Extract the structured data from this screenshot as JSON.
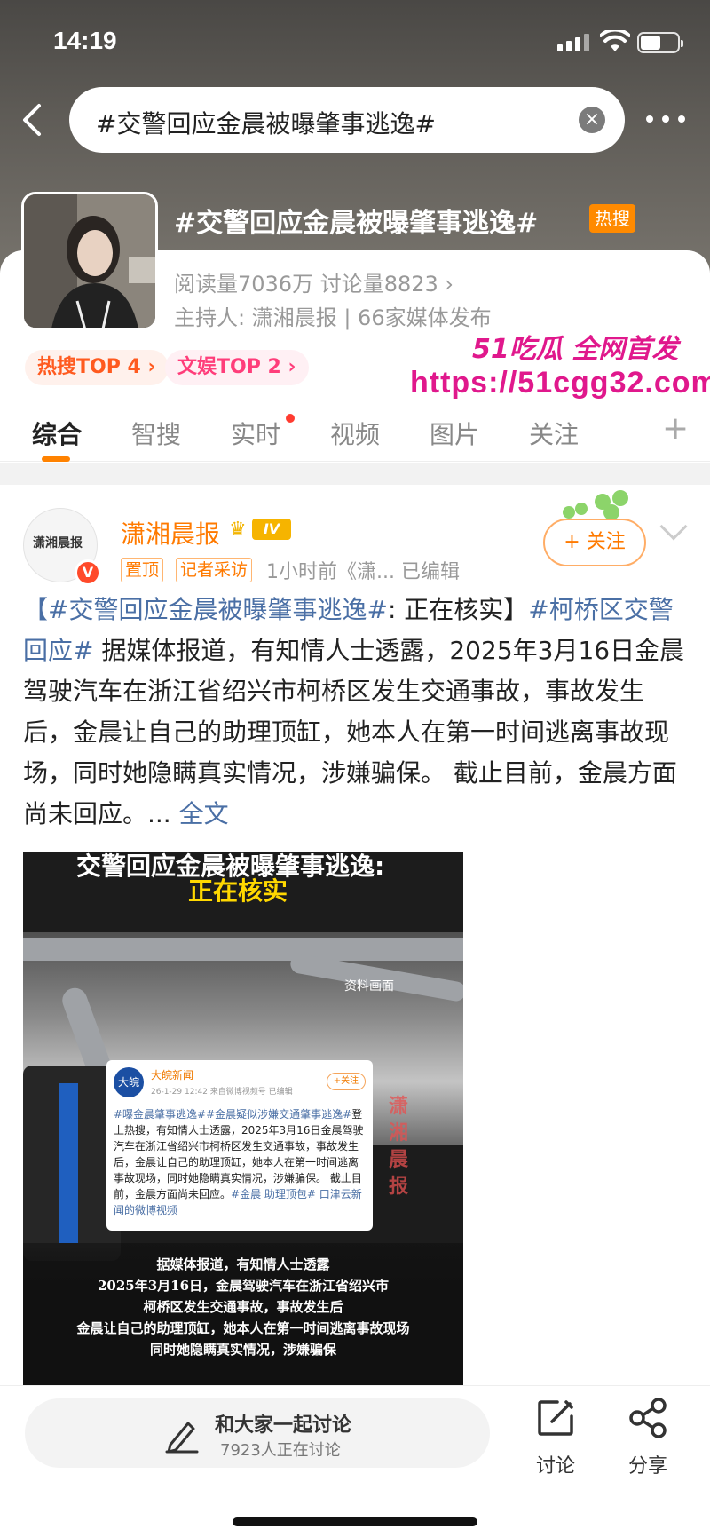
{
  "status": {
    "time": "14:19"
  },
  "search": {
    "query": "#交警回应金晨被曝肇事逃逸#",
    "clear_icon": "clear-x-icon"
  },
  "topic": {
    "title": "#交警回应金晨被曝肇事逃逸#",
    "hot_badge": "热搜",
    "stats": "阅读量7036万  讨论量8823  ›",
    "host": "主持人: 潇湘晨报 | 66家媒体发布",
    "chips": [
      "热搜TOP 4 ›",
      "文娱TOP 2 ›"
    ]
  },
  "watermark": {
    "top": "51吃瓜 全网首发",
    "url": "https://51cgg32.com"
  },
  "tabs": [
    "综合",
    "智搜",
    "实时",
    "视频",
    "图片",
    "关注"
  ],
  "post": {
    "author": "潇湘晨报",
    "avatar_text": "潇湘晨报",
    "level": "IV",
    "tags": [
      "置顶",
      "记者采访"
    ],
    "meta": "1小时前《潇...  已编辑",
    "follow": "+ 关注",
    "body_link1": "【#交警回应金晨被曝肇事逃逸#",
    "body_text1": ": 正在核实】",
    "body_link2": "#柯桥区交警回应#",
    "body_text2": " 据媒体报道，有知情人士透露，2025年3月16日金晨驾驶汽车在浙江省绍兴市柯桥区发生交通事故，事故发生后，金晨让自己的助理顶缸，她本人在第一时间逃离事故现场，同时她隐瞒真实情况，涉嫌骗保。 截止目前，金晨方面尚未回应。... ",
    "body_more": "全文",
    "image": {
      "title1": "交警回应金晨被曝肇事逃逸:",
      "title2": "正在核实",
      "archive_label": "资料画面",
      "side_watermark": "潇湘晨报",
      "mini_card": {
        "logo": "大皖",
        "name": "大皖新闻",
        "time": "26-1-29 12:42 来自微博视频号 已编辑",
        "follow": "+关注",
        "link1": "#曝金晨肇事逃逸#",
        "link2": "#金晨疑似涉嫌交通肇事逃逸#",
        "text": "登上热搜，有知情人士透露，2025年3月16日金晨驾驶汽车在浙江省绍兴市柯桥区发生交通事故，事故发生后，金晨让自己的助理顶缸，她本人在第一时间逃离事故现场，同时她隐瞒真实情况，涉嫌骗保。 截止目前，金晨方面尚未回应。",
        "tail": "#金晨 助理顶包# 口津云新闻的微博视频"
      },
      "caption": [
        "据媒体报道，有知情人士透露",
        "2025年3月16日，金晨驾驶汽车在浙江省绍兴市",
        "柯桥区发生交通事故，事故发生后",
        "金晨让自己的助理顶缸，她本人在第一时间逃离事故现场",
        "同时她隐瞒真实情况，涉嫌骗保"
      ]
    }
  },
  "bottom": {
    "discuss_title": "和大家一起讨论",
    "discuss_sub": "7923人正在讨论",
    "actions": [
      "讨论",
      "分享"
    ]
  }
}
